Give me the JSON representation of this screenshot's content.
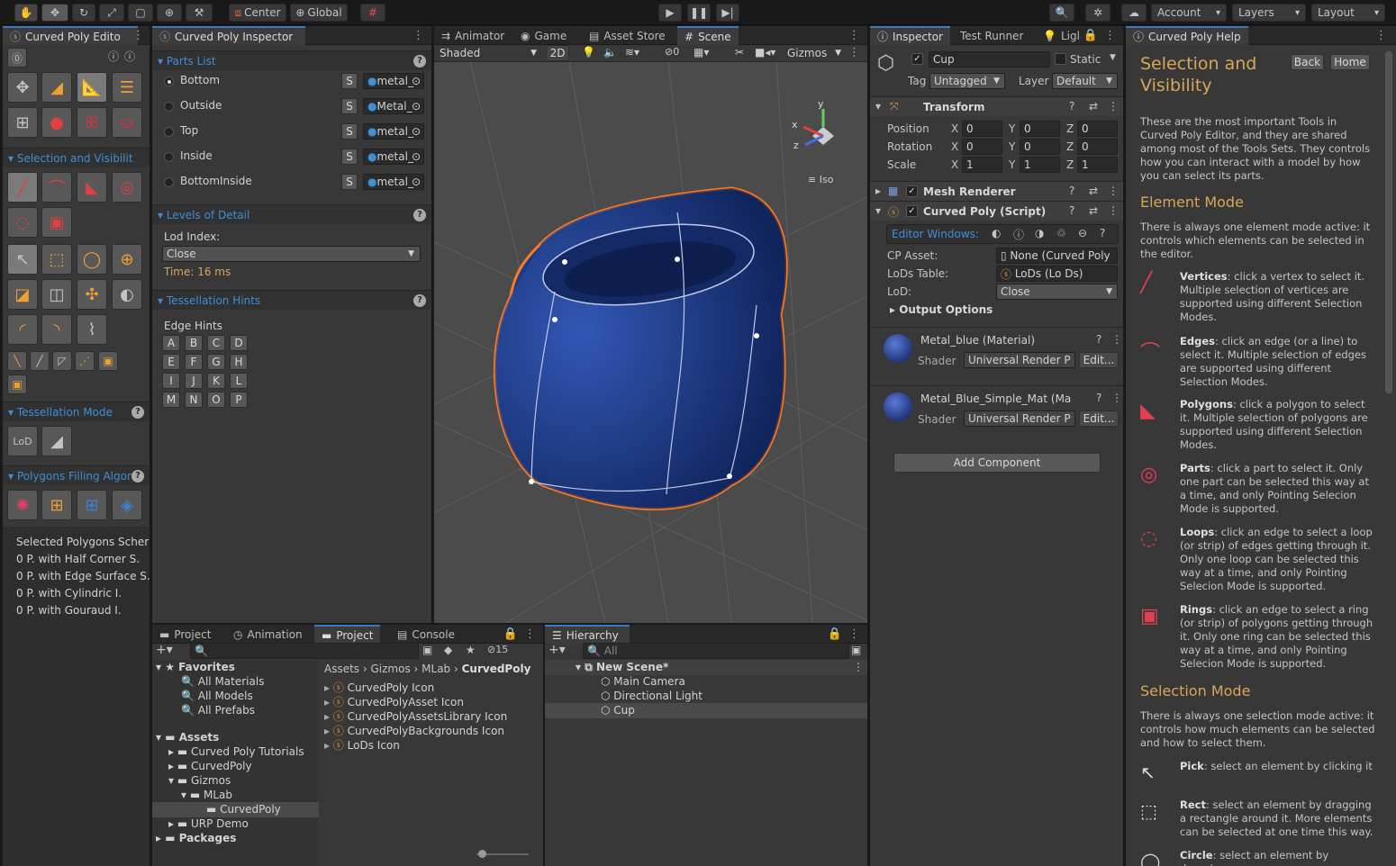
{
  "toolbar": {
    "pivot_center": "Center",
    "pivot_global": "Global",
    "account": "Account",
    "layers": "Layers",
    "layout": "Layout"
  },
  "tools_panel": {
    "title": "Curved Poly Edito",
    "sections": {
      "selection": "Selection and Visibilit",
      "tessellation_mode": "Tessellation Mode",
      "polygons_filling": "Polygons Filling Algor"
    },
    "lod_icon_label": "LoD",
    "selected_schemes_title": "Selected Polygons Scher",
    "selected_schemes": [
      "0 P. with Half Corner S.",
      "0 P. with Edge Surface S.",
      "0 P. with Cylindric I.",
      "0 P. with Gouraud I."
    ]
  },
  "inspector_panel": {
    "title": "Curved Poly Inspector",
    "parts_list_title": "Parts List",
    "parts": [
      {
        "name": "Bottom",
        "s": "S",
        "material": "metal_",
        "selected": true
      },
      {
        "name": "Outside",
        "s": "S",
        "material": "Metal_",
        "selected": false
      },
      {
        "name": "Top",
        "s": "S",
        "material": "metal_",
        "selected": false
      },
      {
        "name": "Inside",
        "s": "S",
        "material": "metal_",
        "selected": false
      },
      {
        "name": "BottomInside",
        "s": "S",
        "material": "metal_",
        "selected": false
      }
    ],
    "lod_title": "Levels of Detail",
    "lod_index_label": "Lod Index:",
    "lod_index_value": "Close",
    "lod_time": "Time: 16 ms",
    "tessellation_hints_title": "Tessellation Hints",
    "edge_hints_label": "Edge Hints",
    "edge_hints": [
      "A",
      "B",
      "C",
      "D",
      "E",
      "F",
      "G",
      "H",
      "I",
      "J",
      "K",
      "L",
      "M",
      "N",
      "O",
      "P"
    ]
  },
  "scene_panel": {
    "tabs": [
      "Animator",
      "Game",
      "Asset Store",
      "Scene"
    ],
    "shading": "Shaded",
    "mode_2d": "2D",
    "hidden_count": "0",
    "gizmos": "Gizmos",
    "axis_x": "x",
    "axis_y": "y",
    "axis_z": "z",
    "projection": "Iso"
  },
  "unity_inspector": {
    "tabs": [
      "Inspector",
      "Test Runner",
      "Ligl"
    ],
    "object_name": "Cup",
    "static_label": "Static",
    "tag_label": "Tag",
    "tag_value": "Untagged",
    "layer_label": "Layer",
    "layer_value": "Default",
    "transform_title": "Transform",
    "transform": {
      "position_label": "Position",
      "rotation_label": "Rotation",
      "scale_label": "Scale",
      "position": [
        "0",
        "0",
        "0"
      ],
      "rotation": [
        "0",
        "0",
        "0"
      ],
      "scale": [
        "1",
        "1",
        "1"
      ]
    },
    "axes": [
      "X",
      "Y",
      "Z"
    ],
    "mesh_renderer": "Mesh Renderer",
    "curved_poly_script": "Curved Poly (Script)",
    "editor_windows_label": "Editor Windows:",
    "cp_asset_label": "CP Asset:",
    "cp_asset_value": "None (Curved Poly",
    "lods_table_label": "LoDs Table:",
    "lods_table_value": "LoDs (Lo Ds)",
    "lod_label": "LoD:",
    "lod_value": "Close",
    "output_options": "Output Options",
    "materials": [
      {
        "name": "Metal_blue (Material)",
        "shader_label": "Shader",
        "shader": "Universal Render P",
        "edit": "Edit..."
      },
      {
        "name": "Metal_Blue_Simple_Mat (Ma",
        "shader_label": "Shader",
        "shader": "Universal Render P",
        "edit": "Edit..."
      }
    ],
    "add_component": "Add Component"
  },
  "help_panel": {
    "title": "Curved Poly Help",
    "back": "Back",
    "home": "Home",
    "heading": "Selection and Visibility",
    "intro": "These are the most important Tools in Curved Poly Editor, and they are shared among most of the Tools Sets. They controls how you can interact with a model by how you can select its parts.",
    "element_mode_title": "Element Mode",
    "element_mode_text": "There is always one element mode active: it controls which elements can be selected in the editor.",
    "element_items": [
      {
        "term": "Vertices",
        "text": ": click a vertex to select it. Multiple selection of vertices are supported using different Selection Modes."
      },
      {
        "term": "Edges",
        "text": ": click an edge (or a line) to select it. Multiple selection of edges are supported using different Selection Modes."
      },
      {
        "term": "Polygons",
        "text": ": click a polygon to select it. Multiple selection of polygons are supported using different Selection Modes."
      },
      {
        "term": "Parts",
        "text": ": click a part to select it. Only one part can be selected this way at a time, and only Pointing Selecion Mode is supported."
      },
      {
        "term": "Loops",
        "text": ": click an edge to select a loop (or strip) of edges getting through it. Only one loop can be selected this way at a time, and only Pointing Selecion Mode is supported."
      },
      {
        "term": "Rings",
        "text": ": click an edge to select a ring (or strip) of polygons getting through it. Only one ring can be selected this way at a time, and only Pointing Selecion Mode is supported."
      }
    ],
    "selection_mode_title": "Selection Mode",
    "selection_mode_text": "There is always one selection mode active: it controls how much elements can be selected and how to select them.",
    "selection_items": [
      {
        "term": "Pick",
        "text": ": select an element by clicking it"
      },
      {
        "term": "Rect",
        "text": ": select an element by dragging a rectangle around it. More elements can be selected at one time this way."
      },
      {
        "term": "Circle",
        "text": ": select an element by dragging"
      }
    ]
  },
  "project_panel": {
    "tabs": [
      "Project",
      "Animation",
      "Project",
      "Console"
    ],
    "hidden_count": "15",
    "favorites": "Favorites",
    "favorite_items": [
      "All Materials",
      "All Models",
      "All Prefabs"
    ],
    "assets": "Assets",
    "asset_folders": [
      "Curved Poly Tutorials",
      "CurvedPoly",
      "Gizmos",
      "MLab",
      "CurvedPoly",
      "URP Demo"
    ],
    "packages": "Packages",
    "breadcrumb": [
      "Assets",
      "Gizmos",
      "MLab",
      "CurvedPoly"
    ],
    "files": [
      "CurvedPoly Icon",
      "CurvedPolyAsset Icon",
      "CurvedPolyAssetsLibrary Icon",
      "CurvedPolyBackgrounds Icon",
      "LoDs Icon"
    ]
  },
  "hierarchy_panel": {
    "title": "Hierarchy",
    "search_placeholder": "All",
    "scene": "New Scene*",
    "items": [
      "Main Camera",
      "Directional Light",
      "Cup"
    ]
  }
}
